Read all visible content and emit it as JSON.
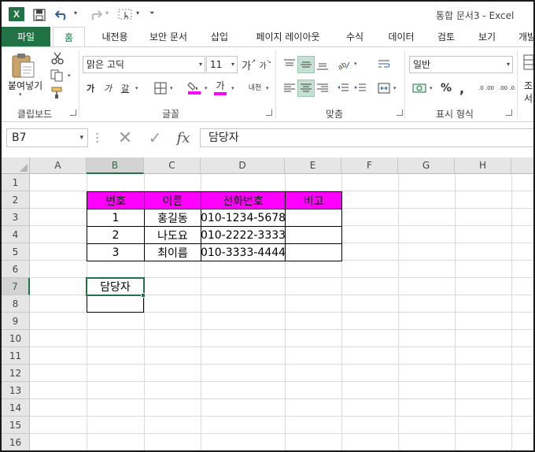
{
  "titlebar": {
    "app_icon": "X",
    "title": "통합 문서3 - Excel"
  },
  "tabs": [
    "파일",
    "홈",
    "내전용",
    "보안 문서",
    "삽입",
    "페이지 레이아웃",
    "수식",
    "데이터",
    "검토",
    "보기",
    "개발"
  ],
  "ribbon": {
    "clipboard": {
      "paste_label": "붙여넣기",
      "group_label": "클립보드"
    },
    "font": {
      "name": "맑은 고딕",
      "size": "11",
      "bold": "가",
      "italic": "가",
      "underline": "갈",
      "font_color_glyph": "가",
      "phonetic": "내천",
      "grow": "가",
      "shrink": "가",
      "group_label": "글꼴"
    },
    "alignment": {
      "group_label": "맞춤"
    },
    "number": {
      "format": "일반",
      "percent": "%",
      "comma": ",",
      "inc_dec": ".0 .00",
      "dec_dec": ".00 .0",
      "group_label": "표시 형식"
    },
    "styles": {
      "cut1": "조",
      "cut2": "서"
    },
    "colors": {
      "accent": "#217346",
      "header_fill": "#ff00ff",
      "highlight": "#ff00ff"
    }
  },
  "formula_bar": {
    "name_box": "B7",
    "fx": "fx",
    "content": "담당자"
  },
  "grid": {
    "columns": [
      "A",
      "B",
      "C",
      "D",
      "E",
      "F",
      "G",
      "H"
    ],
    "active_column": "B",
    "rows": [
      "1",
      "2",
      "3",
      "4",
      "5",
      "6",
      "7",
      "8",
      "9",
      "10",
      "11",
      "12",
      "13",
      "14",
      "15",
      "16"
    ],
    "active_row": "7",
    "table": {
      "headers": [
        "번호",
        "이름",
        "전화번호",
        "비고"
      ],
      "rows": [
        [
          "1",
          "홍길동",
          "010-1234-5678",
          ""
        ],
        [
          "2",
          "나도요",
          "010-2222-3333",
          ""
        ],
        [
          "3",
          "최이름",
          "010-3333-4444",
          ""
        ]
      ]
    },
    "b7": "담당자"
  }
}
